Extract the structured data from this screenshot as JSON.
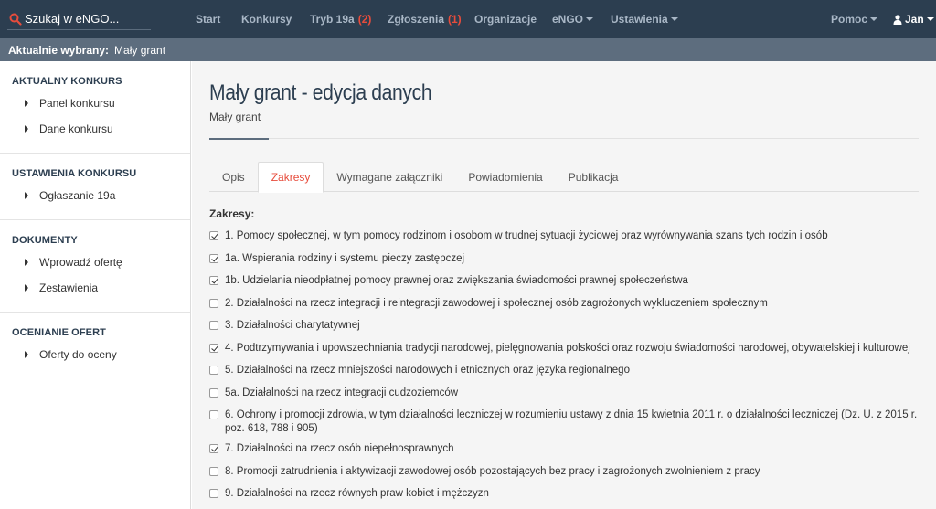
{
  "navbar": {
    "search_placeholder": "Szukaj w eNGO...",
    "items": [
      {
        "label": "Start",
        "badge": ""
      },
      {
        "label": "Konkursy",
        "badge": ""
      },
      {
        "label": "Tryb 19a",
        "badge": "(2)"
      },
      {
        "label": "Zgłoszenia",
        "badge": "(1)"
      },
      {
        "label": "Organizacje",
        "badge": ""
      },
      {
        "label": "eNGO",
        "badge": ""
      },
      {
        "label": "Ustawienia",
        "badge": ""
      }
    ],
    "help": "Pomoc",
    "user": "Jan",
    "badge_color": "#e74c3c"
  },
  "selection": {
    "label": "Aktualnie wybrany:",
    "value": "Mały grant"
  },
  "sidebar": {
    "sections": [
      {
        "title": "AKTUALNY KONKURS",
        "items": [
          "Panel konkursu",
          "Dane konkursu"
        ]
      },
      {
        "title": "USTAWIENIA KONKURSU",
        "items": [
          "Ogłaszanie 19a"
        ]
      },
      {
        "title": "DOKUMENTY",
        "items": [
          "Wprowadź ofertę",
          "Zestawienia"
        ]
      },
      {
        "title": "OCENIANIE OFERT",
        "items": [
          "Oferty do oceny"
        ]
      }
    ]
  },
  "page": {
    "title": "Mały grant - edycja danych",
    "subtitle": "Mały grant"
  },
  "tabs": [
    {
      "label": "Opis",
      "active": false
    },
    {
      "label": "Zakresy",
      "active": true
    },
    {
      "label": "Wymagane załączniki",
      "active": false
    },
    {
      "label": "Powiadomienia",
      "active": false
    },
    {
      "label": "Publikacja",
      "active": false
    }
  ],
  "scopes": {
    "label": "Zakresy:",
    "items": [
      {
        "text": "1. Pomocy społecznej, w tym pomocy rodzinom i osobom w trudnej sytuacji życiowej oraz wyrównywania szans tych rodzin i osób",
        "checked": true
      },
      {
        "text": "1a. Wspierania rodziny i systemu pieczy zastępczej",
        "checked": true
      },
      {
        "text": "1b. Udzielania nieodpłatnej pomocy prawnej oraz zwiększania świadomości prawnej społeczeństwa",
        "checked": true
      },
      {
        "text": "2. Działalności na rzecz integracji i reintegracji zawodowej i społecznej osób zagrożonych wykluczeniem społecznym",
        "checked": false
      },
      {
        "text": "3. Działalności charytatywnej",
        "checked": false
      },
      {
        "text": "4. Podtrzymywania i upowszechniania tradycji narodowej, pielęgnowania polskości oraz rozwoju świadomości narodowej, obywatelskiej i kulturowej",
        "checked": true
      },
      {
        "text": "5. Działalności na rzecz mniejszości narodowych i etnicznych oraz języka regionalnego",
        "checked": false
      },
      {
        "text": "5a. Działalności na rzecz integracji cudzoziemców",
        "checked": false
      },
      {
        "text": "6. Ochrony i promocji zdrowia, w tym działalności leczniczej w rozumieniu ustawy z dnia 15 kwietnia 2011 r. o działalności leczniczej (Dz. U. z 2015 r. poz. 618, 788 i 905)",
        "checked": false
      },
      {
        "text": "7. Działalności na rzecz osób niepełnosprawnych",
        "checked": true
      },
      {
        "text": "8. Promocji zatrudnienia i aktywizacji zawodowej osób pozostających bez pracy i zagrożonych zwolnieniem z pracy",
        "checked": false
      },
      {
        "text": "9. Działalności na rzecz równych praw kobiet i mężczyzn",
        "checked": false
      }
    ]
  }
}
